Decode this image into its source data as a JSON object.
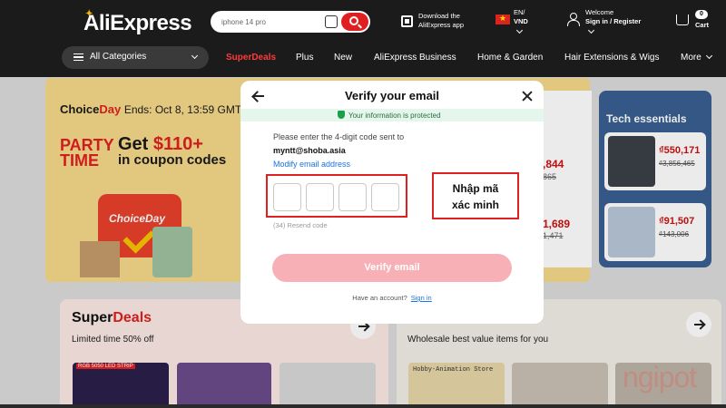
{
  "header": {
    "logo": "AliExpress",
    "search_value": "iphone 14 pro",
    "download_line1": "Download the",
    "download_line2": "AliExpress app",
    "region_line1": "EN/",
    "region_line2": "VND",
    "account_line1": "Welcome",
    "account_line2": "Sign in / Register",
    "cart_count": "0",
    "cart_label": "Cart",
    "categories_label": "All Categories",
    "nav": [
      "SuperDeals",
      "Plus",
      "New",
      "AliExpress Business",
      "Home & Garden",
      "Hair Extensions & Wigs",
      "More"
    ],
    "brand_color": "#e02020"
  },
  "promo": {
    "choice": "Choice",
    "day": "Day",
    "ends": "Ends: Oct 8, 13:59 GMT-",
    "party": "PARTY",
    "time": "TIME",
    "get": "Get ",
    "amount": "$110+",
    "coupons": "in coupon codes",
    "badge": "ChoiceDay"
  },
  "deals_column": {
    "items": [
      {
        "price": ",844",
        "old": "865"
      },
      {
        "price": "1,689",
        "old": "1,471"
      }
    ]
  },
  "tech": {
    "title": "Tech essentials",
    "items": [
      {
        "price": "₫550,171",
        "old": "₫3,856,465"
      },
      {
        "price": "₫91,507",
        "old": "₫143,006"
      }
    ]
  },
  "superdeals": {
    "title_a": "Super",
    "title_b": "Deals",
    "subtitle": "Limited time 50% off",
    "led_label": "RGB 5050 LED STRIP"
  },
  "wholesale": {
    "subtitle": "Wholesale best value items for you",
    "store_label": "Hobby-Animation Store"
  },
  "modal": {
    "title": "Verify your email",
    "protected": "Your information is protected",
    "instruction": "Please enter the 4-digit code sent to",
    "email": "myntt@shoba.asia",
    "modify": "Modify email address",
    "code_digits": [
      "",
      "",
      "",
      ""
    ],
    "resend": "(34) Resend code",
    "verify_button": "Verify email",
    "have_account": "Have an account?",
    "sign_in": "Sign in"
  },
  "annotation": {
    "line1": "Nhập mã",
    "line2": "xác minh"
  },
  "watermark": "ngipot"
}
